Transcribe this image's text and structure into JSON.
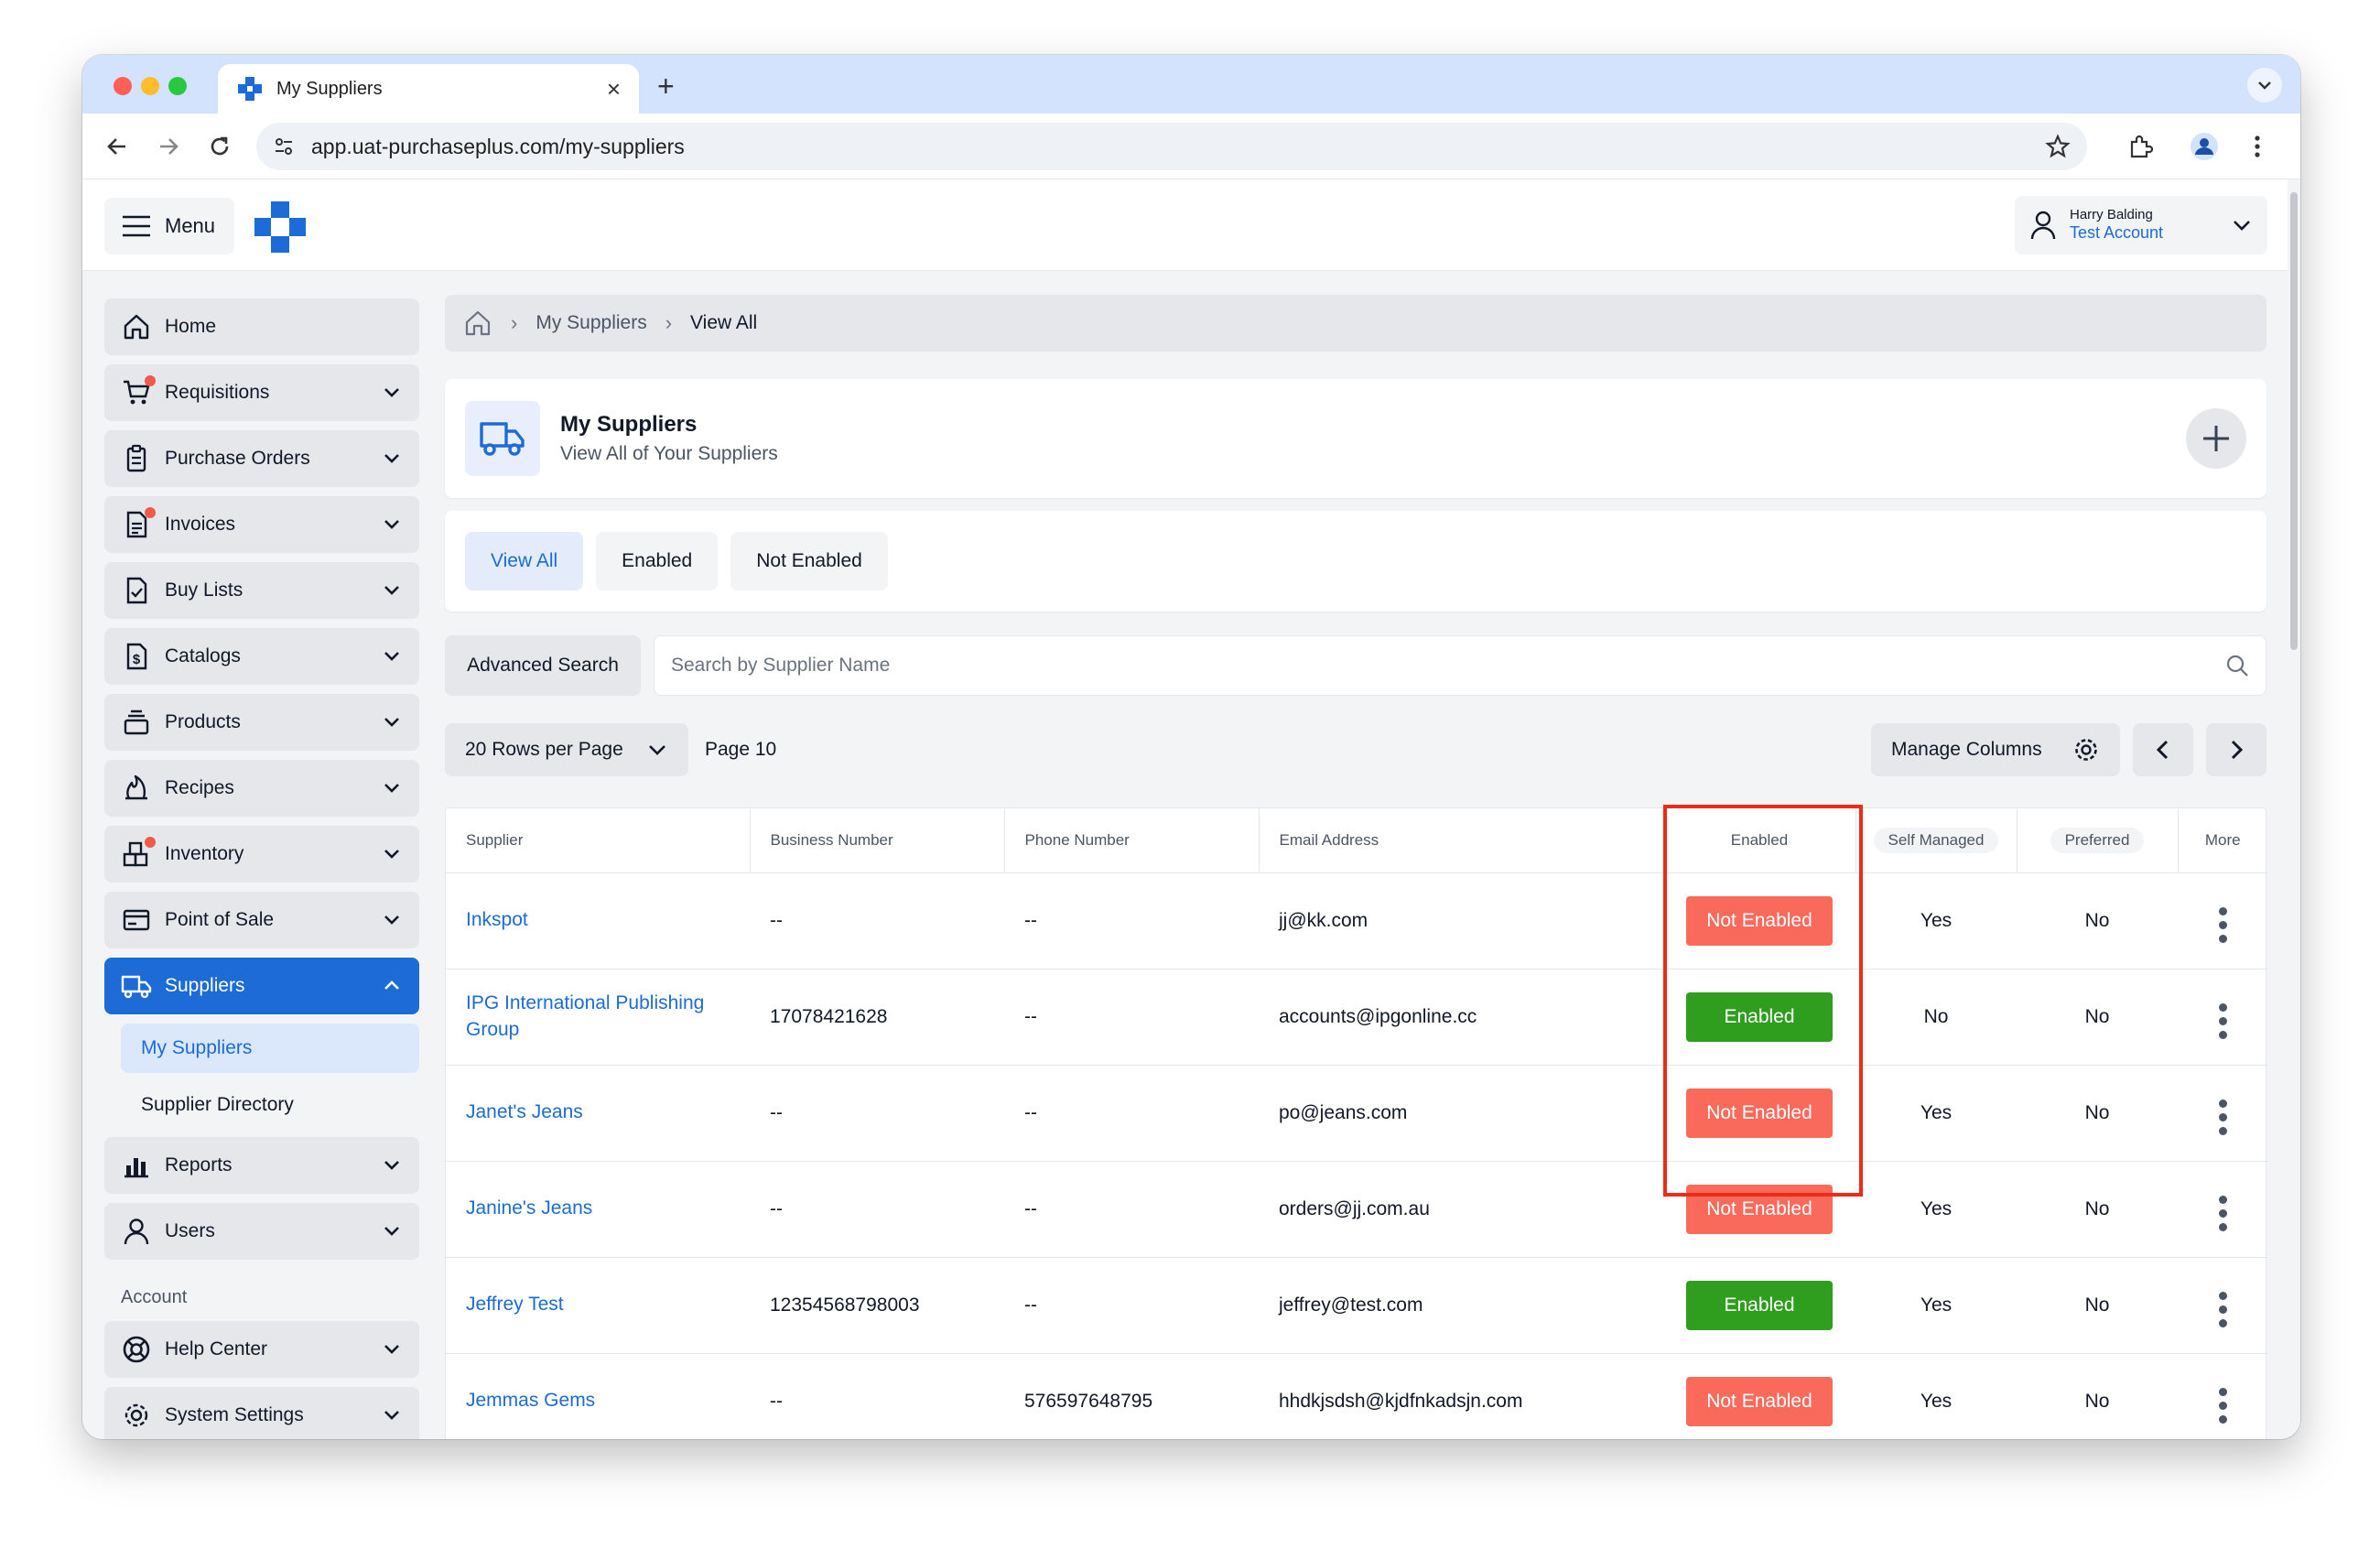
{
  "browser": {
    "tab_title": "My Suppliers",
    "new_tab": "+",
    "close": "×",
    "url": "app.uat-purchaseplus.com/my-suppliers"
  },
  "header": {
    "menu_label": "Menu",
    "user_name": "Harry Balding",
    "user_account": "Test Account"
  },
  "sidebar": {
    "items": [
      {
        "label": "Home",
        "icon": "home-icon",
        "chevron": false,
        "dot": false
      },
      {
        "label": "Requisitions",
        "icon": "cart-icon",
        "chevron": true,
        "dot": true
      },
      {
        "label": "Purchase Orders",
        "icon": "clipboard-icon",
        "chevron": true,
        "dot": false
      },
      {
        "label": "Invoices",
        "icon": "invoice-icon",
        "chevron": true,
        "dot": true
      },
      {
        "label": "Buy Lists",
        "icon": "checklist-icon",
        "chevron": true,
        "dot": false
      },
      {
        "label": "Catalogs",
        "icon": "dollar-doc-icon",
        "chevron": true,
        "dot": false
      },
      {
        "label": "Products",
        "icon": "stack-icon",
        "chevron": true,
        "dot": false
      },
      {
        "label": "Recipes",
        "icon": "flame-icon",
        "chevron": true,
        "dot": false
      },
      {
        "label": "Inventory",
        "icon": "boxes-icon",
        "chevron": true,
        "dot": true
      },
      {
        "label": "Point of Sale",
        "icon": "card-icon",
        "chevron": true,
        "dot": false
      },
      {
        "label": "Suppliers",
        "icon": "truck-icon",
        "chevron": true,
        "dot": false,
        "active": true
      }
    ],
    "sub_items": [
      {
        "label": "My Suppliers",
        "active": true
      },
      {
        "label": "Supplier Directory",
        "active": false
      }
    ],
    "items_after": [
      {
        "label": "Reports",
        "icon": "bar-chart-icon"
      },
      {
        "label": "Users",
        "icon": "user-icon"
      }
    ],
    "section_label": "Account",
    "account_items": [
      {
        "label": "Help Center",
        "icon": "lifebuoy-icon"
      },
      {
        "label": "System Settings",
        "icon": "gear-icon"
      }
    ]
  },
  "breadcrumb": {
    "items": [
      "My Suppliers",
      "View All"
    ]
  },
  "page": {
    "title": "My Suppliers",
    "subtitle": "View All of Your Suppliers"
  },
  "filters": {
    "tabs": [
      {
        "label": "View All",
        "active": true
      },
      {
        "label": "Enabled",
        "active": false
      },
      {
        "label": "Not Enabled",
        "active": false
      }
    ]
  },
  "search": {
    "advanced_label": "Advanced Search",
    "placeholder": "Search by Supplier Name",
    "value": ""
  },
  "pager": {
    "rows_label": "20 Rows per Page",
    "page_label": "Page 10",
    "manage_label": "Manage Columns"
  },
  "table": {
    "columns": [
      "Supplier",
      "Business Number",
      "Phone Number",
      "Email Address",
      "Enabled",
      "Self Managed",
      "Preferred",
      "More"
    ],
    "rows": [
      {
        "supplier": "Inkspot",
        "business": "--",
        "phone": "--",
        "email": "jj@kk.com",
        "enabled": "Not Enabled",
        "enabled_flag": false,
        "self_managed": "Yes",
        "preferred": "No"
      },
      {
        "supplier": "IPG International Publishing Group",
        "business": "17078421628",
        "phone": "--",
        "email": "accounts@ipgonline.cc",
        "enabled": "Enabled",
        "enabled_flag": true,
        "self_managed": "No",
        "preferred": "No"
      },
      {
        "supplier": "Janet's Jeans",
        "business": "--",
        "phone": "--",
        "email": "po@jeans.com",
        "enabled": "Not Enabled",
        "enabled_flag": false,
        "self_managed": "Yes",
        "preferred": "No"
      },
      {
        "supplier": "Janine's Jeans",
        "business": "--",
        "phone": "--",
        "email": "orders@jj.com.au",
        "enabled": "Not Enabled",
        "enabled_flag": false,
        "self_managed": "Yes",
        "preferred": "No"
      },
      {
        "supplier": "Jeffrey Test",
        "business": "12354568798003",
        "phone": "--",
        "email": "jeffrey@test.com",
        "enabled": "Enabled",
        "enabled_flag": true,
        "self_managed": "Yes",
        "preferred": "No"
      },
      {
        "supplier": "Jemmas Gems",
        "business": "--",
        "phone": "576597648795",
        "email": "hhdkjsdsh@kjdfnkadsjn.com",
        "enabled": "Not Enabled",
        "enabled_flag": false,
        "self_managed": "Yes",
        "preferred": "No"
      }
    ]
  },
  "colors": {
    "accent": "#1d6bd6",
    "enabled": "#2f9e1f",
    "not_enabled": "#f96a5a",
    "highlight": "#ee2b17"
  }
}
